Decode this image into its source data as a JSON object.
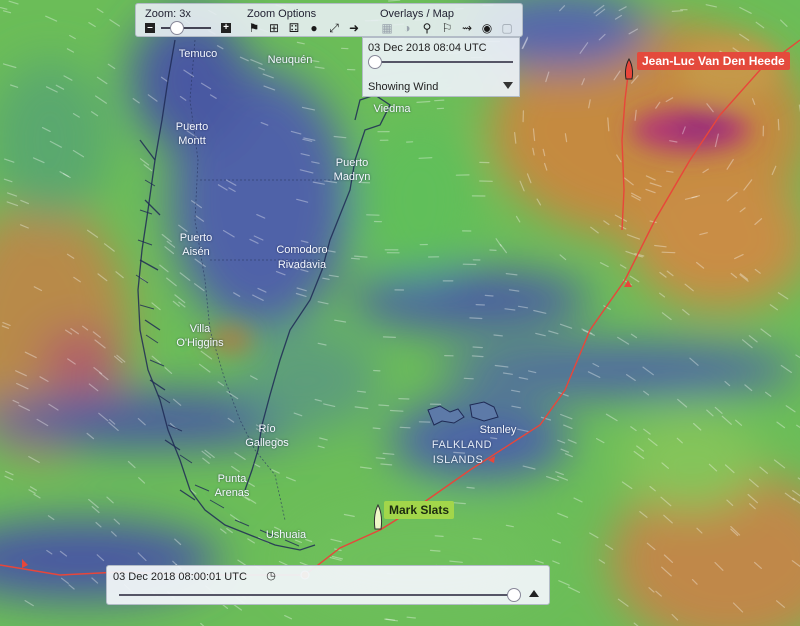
{
  "toolbar": {
    "zoom_label": "Zoom: 3x",
    "zoom_minus": "–",
    "zoom_plus": "+",
    "zoom_options_label": "Zoom Options",
    "overlays_label": "Overlays / Map",
    "zoom_level": 3,
    "zoom_icons": [
      "flag-icon",
      "plus-square-icon",
      "dice-icon",
      "group-icon",
      "expand-icon",
      "login-icon"
    ],
    "overlay_icons": [
      "grid-icon",
      "half-circle-icon",
      "pin-icon",
      "flags-icon",
      "route-icon",
      "globe-icon",
      "square-icon"
    ]
  },
  "overlay_panel": {
    "datetime": "03 Dec 2018 08:04 UTC",
    "mode": "Showing Wind"
  },
  "timeline": {
    "datetime": "03 Dec 2018 08:00:01 UTC"
  },
  "boats": [
    {
      "name": "Jean-Luc Van Den Heede",
      "color": "#e44a3c"
    },
    {
      "name": "Mark Slats",
      "color": "#a2d64a"
    }
  ],
  "places": {
    "temuco": "Temuco",
    "neuquen": "Neuquén",
    "viedma": "Viedma",
    "puerto_montt_1": "Puerto",
    "puerto_montt_2": "Montt",
    "puerto_madryn_1": "Puerto",
    "puerto_madryn_2": "Madryn",
    "puerto_aisen_1": "Puerto",
    "puerto_aisen_2": "Aisén",
    "comodoro_1": "Comodoro",
    "comodoro_2": "Rivadavia",
    "villa_ohiggins_1": "Villa",
    "villa_ohiggins_2": "O'Higgins",
    "rio_gallegos_1": "Río",
    "rio_gallegos_2": "Gallegos",
    "punta_arenas_1": "Punta",
    "punta_arenas_2": "Arenas",
    "ushuaia": "Ushuaia",
    "stanley": "Stanley",
    "falkland_1": "FALKLAND",
    "falkland_2": "ISLANDS"
  },
  "colors": {
    "route": "#e8463a",
    "wind_low": "#3e4f9e",
    "wind_mid": "#6fbf5a",
    "wind_high": "#c9863f",
    "wind_extreme": "#b0386e"
  }
}
